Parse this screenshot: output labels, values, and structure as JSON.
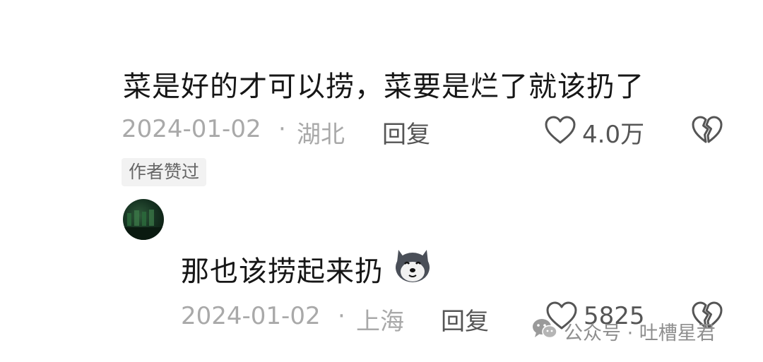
{
  "comment": {
    "text": "菜是好的才可以捞，菜要是烂了就该扔了",
    "date": "2024-01-02",
    "separator": "·",
    "location": "湖北",
    "reply_label": "回复",
    "like_count": "4.0万",
    "author_liked_badge": "作者赞过"
  },
  "reply": {
    "text": "那也该捞起来扔",
    "emoji_icon": "husky-dog-emoji",
    "date": "2024-01-02",
    "separator": "·",
    "location": "上海",
    "reply_label": "回复",
    "like_count": "5825"
  },
  "watermark": {
    "text": "公众号 · 吐槽星君",
    "icon": "wechat-icon"
  }
}
